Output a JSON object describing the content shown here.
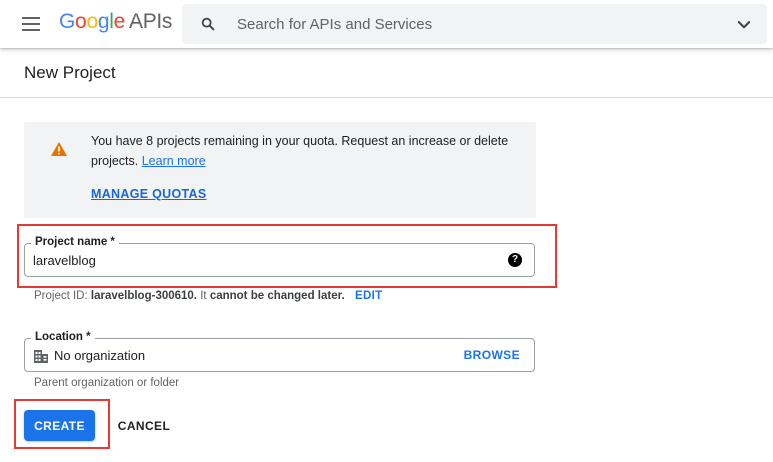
{
  "header": {
    "logo_google": [
      "G",
      "o",
      "o",
      "g",
      "l",
      "e"
    ],
    "logo_apis": "APIs",
    "search_placeholder": "Search for APIs and Services"
  },
  "page": {
    "title": "New Project"
  },
  "notice": {
    "text": "You have 8 projects remaining in your quota. Request an increase or delete projects.",
    "learn_more": "Learn more",
    "manage_quotas": "MANAGE QUOTAS"
  },
  "project_field": {
    "label": "Project name *",
    "value": "laravelblog",
    "help": "?"
  },
  "project_id": {
    "prefix": "Project ID:",
    "id": "laravelblog-300610.",
    "middle": "It",
    "emphasis": "cannot be changed later.",
    "edit": "EDIT"
  },
  "location_field": {
    "label": "Location *",
    "value": "No organization",
    "browse": "BROWSE",
    "helper": "Parent organization or folder"
  },
  "actions": {
    "create": "CREATE",
    "cancel": "CANCEL"
  },
  "colors": {
    "primary": "#1a73e8",
    "warning": "#e37400",
    "highlight": "#e53935"
  }
}
